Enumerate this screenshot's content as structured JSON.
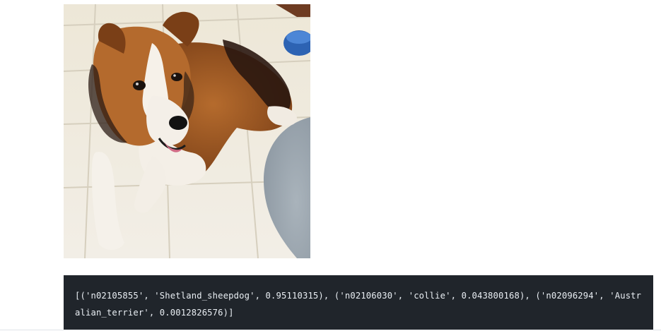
{
  "image": {
    "alt": "dog-photo"
  },
  "output": {
    "text": "[('n02105855', 'Shetland_sheepdog', 0.95110315), ('n02106030', 'collie', 0.043800168), ('n02096294', 'Australian_terrier', 0.0012826576)]"
  },
  "colors": {
    "code_background": "#20252b",
    "code_text": "#e9eef3",
    "page_background": "#ffffff"
  }
}
